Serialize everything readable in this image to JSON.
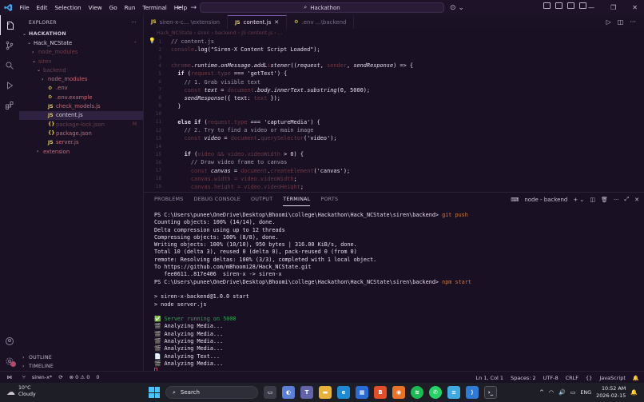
{
  "titlebar": {
    "menu": [
      "File",
      "Edit",
      "Selection",
      "View",
      "Go",
      "Run",
      "Terminal",
      "Help"
    ],
    "search": "Hackathon"
  },
  "sidebar": {
    "header": "EXPLORER",
    "more": "···",
    "root": "HACKATHON",
    "items": [
      {
        "label": "Hack_NCState",
        "indent": 1,
        "chev": "⌄",
        "cls": "c-light",
        "badge": "•",
        "badge_cls": "c-dim"
      },
      {
        "label": "node_modules",
        "indent": 2,
        "chev": "›",
        "cls": "c-dim",
        "badge": "",
        "badge_cls": ""
      },
      {
        "label": "siren",
        "indent": 2,
        "chev": "⌄",
        "cls": "c-dim",
        "badge": "",
        "badge_cls": ""
      },
      {
        "label": "backend",
        "indent": 3,
        "chev": "⌄",
        "cls": "c-dim",
        "badge": "",
        "badge_cls": ""
      },
      {
        "label": "node_modules",
        "indent": 4,
        "chev": "›",
        "cls": "c-red",
        "badge": "",
        "badge_cls": ""
      },
      {
        "label": ".env",
        "indent": 4,
        "chev": "",
        "icon": "⚙",
        "icon_cls": "c-js",
        "cls": "c-red",
        "badge": "",
        "badge_cls": ""
      },
      {
        "label": ".env.example",
        "indent": 4,
        "chev": "",
        "icon": "⚙",
        "icon_cls": "c-js",
        "cls": "c-red",
        "badge": "",
        "badge_cls": ""
      },
      {
        "label": "check_models.js",
        "indent": 4,
        "chev": "",
        "icon": "JS",
        "icon_cls": "c-js",
        "cls": "c-red",
        "badge": "",
        "badge_cls": ""
      },
      {
        "label": "content.js",
        "indent": 4,
        "chev": "",
        "icon": "JS",
        "icon_cls": "c-js",
        "cls": "c-light",
        "badge": "",
        "badge_cls": "",
        "selected": true
      },
      {
        "label": "package-lock.json",
        "indent": 4,
        "chev": "",
        "icon": "{}",
        "icon_cls": "c-json",
        "cls": "c-dim",
        "badge": "M",
        "badge_cls": "c-dim"
      },
      {
        "label": "package.json",
        "indent": 4,
        "chev": "",
        "icon": "{}",
        "icon_cls": "c-json",
        "cls": "c-red",
        "badge": "",
        "badge_cls": ""
      },
      {
        "label": "server.js",
        "indent": 4,
        "chev": "",
        "icon": "JS",
        "icon_cls": "c-js",
        "cls": "c-red",
        "badge": "",
        "badge_cls": ""
      },
      {
        "label": "extension",
        "indent": 3,
        "chev": "›",
        "cls": "c-red",
        "badge": "",
        "badge_cls": ""
      }
    ],
    "outline": "OUTLINE",
    "timeline": "TIMELINE"
  },
  "tabs": [
    {
      "label": "siren-x-c... \\extension",
      "icon": "JS",
      "active": false
    },
    {
      "label": "content.js",
      "icon": "JS",
      "active": true,
      "close": "✕"
    },
    {
      "label": ".env ...\\backend",
      "icon": "⚙",
      "active": false
    }
  ],
  "breadcrumb": "Hack_NCState › siren › backend › JS content.js › ...",
  "code": [
    {
      "n": "1",
      "html": "<span class='cm'>// content.js</span>"
    },
    {
      "n": "2",
      "html": "<span class='dm'>console</span><span class='p'>.log(</span><span class='s'>\"Siren-X Content Script Loaded\"</span><span class='p'>);</span>"
    },
    {
      "n": "3",
      "html": ""
    },
    {
      "n": "4",
      "html": "<span class='dm'>chrome</span><span class='p'>.</span><span class='i'>runtime</span><span class='p'>.</span><span class='i'>onMessage</span><span class='p'>.</span><span class='i'>addL</span><span class='dm'>i</span><span class='i'>stener</span><span class='p'>((</span><span class='i'>request</span><span class='p'>, </span><span class='dm'>sender</span><span class='p'>, </span><span class='i'>sendResponse</span><span class='p'>) => {</span>"
    },
    {
      "n": "5",
      "html": "  <span class='k'>if</span><span class='p'> (</span><span class='dm'>request.type</span><span class='p'> === </span><span class='s'>'getText'</span><span class='p'>) {</span>"
    },
    {
      "n": "6",
      "html": "    <span class='cm'>// 1. Grab visible text</span>"
    },
    {
      "n": "7",
      "html": "    <span class='dm'>const</span> <span class='i'>text</span><span class='p'> = </span><span class='dm'>document</span><span class='p'>.</span><span class='i'>body</span><span class='p'>.</span><span class='i'>innerText</span><span class='p'>.</span><span class='i'>substring</span><span class='p'>(0, 5000);</span>"
    },
    {
      "n": "8",
      "html": "    <span class='i'>sendResponse</span><span class='p'>({ text: </span><span class='dm'>text</span><span class='p'> });</span>"
    },
    {
      "n": "9",
      "html": "  <span class='p'>}</span>"
    },
    {
      "n": "10",
      "html": ""
    },
    {
      "n": "11",
      "html": "  <span class='k'>else if</span><span class='p'> (</span><span class='dm'>request.type</span><span class='p'> === </span><span class='s'>'captureMedia'</span><span class='p'>) {</span>"
    },
    {
      "n": "12",
      "html": "    <span class='cm'>// 2. Try to find a video or main image</span>"
    },
    {
      "n": "13",
      "html": "    <span class='dm'>const</span> <span class='i'>video</span><span class='p'> = </span><span class='dm'>document</span><span class='p'>.</span><span class='dm'>querySelector</span><span class='p'>(</span><span class='s'>'video'</span><span class='p'>);</span>"
    },
    {
      "n": "14",
      "html": ""
    },
    {
      "n": "15",
      "html": "    <span class='k'>if</span><span class='p'> (</span><span class='dm'>video && video.videoWidth</span><span class='p'> > 0) {</span>"
    },
    {
      "n": "16",
      "html": "      <span class='cm'>// Draw video frame to canvas</span>"
    },
    {
      "n": "17",
      "html": "      <span class='dm'>const</span> <span class='i'>canvas</span><span class='p'> = </span><span class='dm'>document</span><span class='p'>.</span><span class='dm'>createElement</span><span class='p'>(</span><span class='s'>'canvas'</span><span class='p'>);</span>"
    },
    {
      "n": "18",
      "html": "      <span class='dm'>canvas.width = video.videoWidth</span><span class='p'>;</span>"
    },
    {
      "n": "19",
      "html": "      <span class='dm'>canvas.height = video.videoHeight</span><span class='p'>;</span>"
    }
  ],
  "panel": {
    "tabs": [
      "PROBLEMS",
      "DEBUG CONSOLE",
      "OUTPUT",
      "TERMINAL",
      "PORTS"
    ],
    "active_tab": "TERMINAL",
    "terminal_name": "node - backend",
    "lines": [
      {
        "t": "PS C:\\Users\\punee\\OneDrive\\Desktop\\Bhoomi\\college\\Hackathon\\Hack_NCState\\siren\\backend> ",
        "c": "git push"
      },
      {
        "t": "Counting objects: 100% (14/14), done."
      },
      {
        "t": "Delta compression using up to 12 threads"
      },
      {
        "t": "Compressing objects: 100% (8/8), done."
      },
      {
        "t": "Writing objects: 100% (10/10), 950 bytes | 316.00 KiB/s, done."
      },
      {
        "t": "Total 10 (delta 3), reused 0 (delta 0), pack-reused 0 (from 0)"
      },
      {
        "t": "remote: Resolving deltas: 100% (3/3), completed with 1 local object."
      },
      {
        "t": "To https://github.com/mBhoomi28/Hack_NCState.git"
      },
      {
        "t": "   fee0611..817e406  siren-x -> siren-x"
      },
      {
        "t": "PS C:\\Users\\punee\\OneDrive\\Desktop\\Bhoomi\\college\\Hackathon\\Hack_NCState\\siren\\backend> ",
        "c": "npm start"
      },
      {
        "t": ""
      },
      {
        "t": "> siren-x-backend@1.0.0 start"
      },
      {
        "t": "> node server.js"
      },
      {
        "t": ""
      },
      {
        "t": "✅ Server running on 5000",
        "cls": "ok"
      },
      {
        "t": "🎬 Analyzing Media..."
      },
      {
        "t": "🎬 Analyzing Media..."
      },
      {
        "t": "🎬 Analyzing Media..."
      },
      {
        "t": "🎬 Analyzing Media..."
      },
      {
        "t": "📄 Analyzing Text..."
      },
      {
        "t": "🎬 Analyzing Media..."
      }
    ]
  },
  "status": {
    "branch": "siren-x*",
    "errors": "⊗ 0 ⚠ 0",
    "warnings": "0",
    "position": "Ln 1, Col 1",
    "spaces": "Spaces: 2",
    "encoding": "UTF-8",
    "eol": "CRLF",
    "language": "JavaScript"
  },
  "taskbar": {
    "temp": "10°C",
    "weather": "Cloudy",
    "search": "Search",
    "lang": "ENG",
    "time": "10:52 AM",
    "date": "2026-02-15"
  }
}
